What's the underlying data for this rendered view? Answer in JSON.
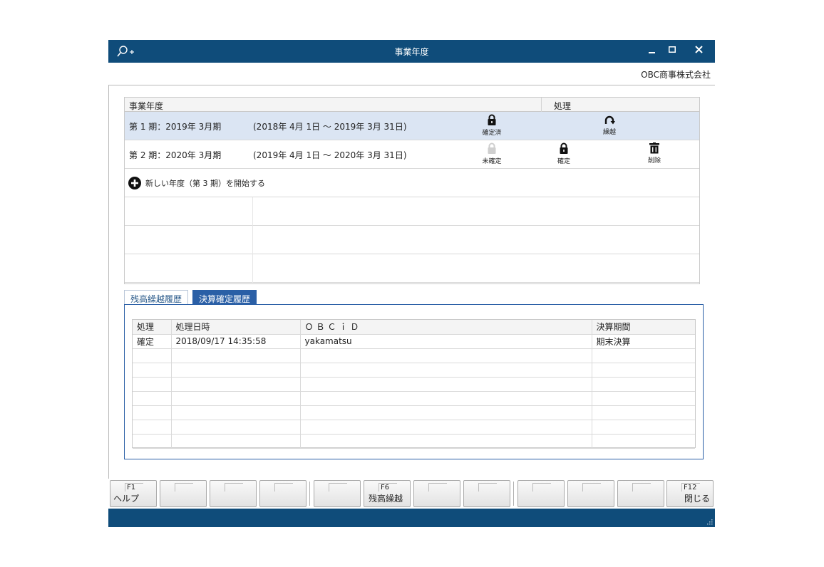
{
  "window": {
    "title": "事業年度",
    "company": "OBC商事株式会社"
  },
  "year_grid": {
    "headers": {
      "year": "事業年度",
      "process": "処理"
    },
    "rows": [
      {
        "period": "第 1 期：2019年  3月期",
        "range": "(2018年  4月  1日 ～ 2019年  3月 31日)",
        "status_label": "確定済",
        "action_label": "繰越"
      },
      {
        "period": "第 2 期：2020年  3月期",
        "range": "(2019年  4月  1日 ～ 2020年  3月 31日)",
        "status_label": "未確定",
        "confirm_label": "確定",
        "delete_label": "削除"
      }
    ],
    "add_label": "新しい年度（第 3 期）を開始する"
  },
  "tabs": [
    {
      "label": "残高繰越履歴"
    },
    {
      "label": "決算確定履歴"
    }
  ],
  "history": {
    "headers": [
      "処理",
      "処理日時",
      "ＯＢＣｉＤ",
      "決算期間"
    ],
    "rows": [
      [
        "確定",
        "2018/09/17 14:35:58",
        "yakamatsu",
        "期末決算"
      ]
    ]
  },
  "fkeys": {
    "f1": {
      "num": "F1",
      "label": "ヘルプ"
    },
    "f6": {
      "num": "F6",
      "label": "残高繰越"
    },
    "f12": {
      "num": "F12",
      "label": "閉じる"
    }
  }
}
